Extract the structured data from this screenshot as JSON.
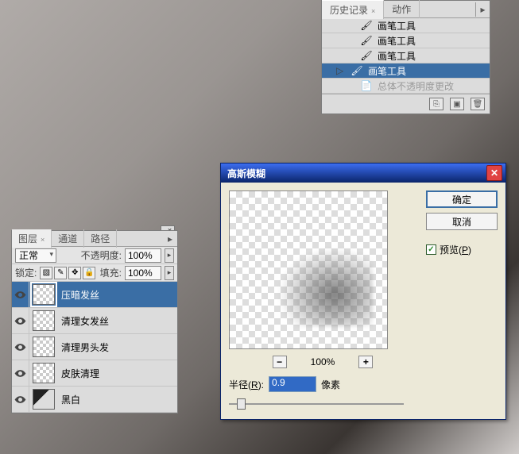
{
  "history_panel": {
    "tabs": {
      "history": "历史记录",
      "actions": "动作"
    },
    "items": [
      {
        "label": "画笔工具",
        "selected": false,
        "dim": false,
        "has_pointer": false
      },
      {
        "label": "画笔工具",
        "selected": false,
        "dim": false,
        "has_pointer": false
      },
      {
        "label": "画笔工具",
        "selected": false,
        "dim": false,
        "has_pointer": false
      },
      {
        "label": "画笔工具",
        "selected": true,
        "dim": false,
        "has_pointer": true
      },
      {
        "label": "总体不透明度更改",
        "selected": false,
        "dim": true,
        "has_pointer": false
      }
    ]
  },
  "layers_panel": {
    "tabs": {
      "layers": "图层",
      "channels": "通道",
      "paths": "路径"
    },
    "blend_label": "正常",
    "opacity_label": "不透明度:",
    "opacity_value": "100%",
    "lock_label": "锁定:",
    "fill_label": "填充:",
    "fill_value": "100%",
    "layers": [
      {
        "name": "压暗发丝",
        "selected": true
      },
      {
        "name": "清理女发丝",
        "selected": false
      },
      {
        "name": "清理男头发",
        "selected": false
      },
      {
        "name": "皮肤清理",
        "selected": false
      },
      {
        "name": "黑白",
        "selected": false
      }
    ]
  },
  "dialog": {
    "title": "高斯模糊",
    "ok": "确定",
    "cancel": "取消",
    "preview": "预览",
    "preview_hotkey": "P",
    "zoom": "100%",
    "radius_label": "半径",
    "radius_hotkey": "R",
    "radius_value": "0.9",
    "radius_unit": "像素",
    "minus": "−",
    "plus": "+"
  }
}
